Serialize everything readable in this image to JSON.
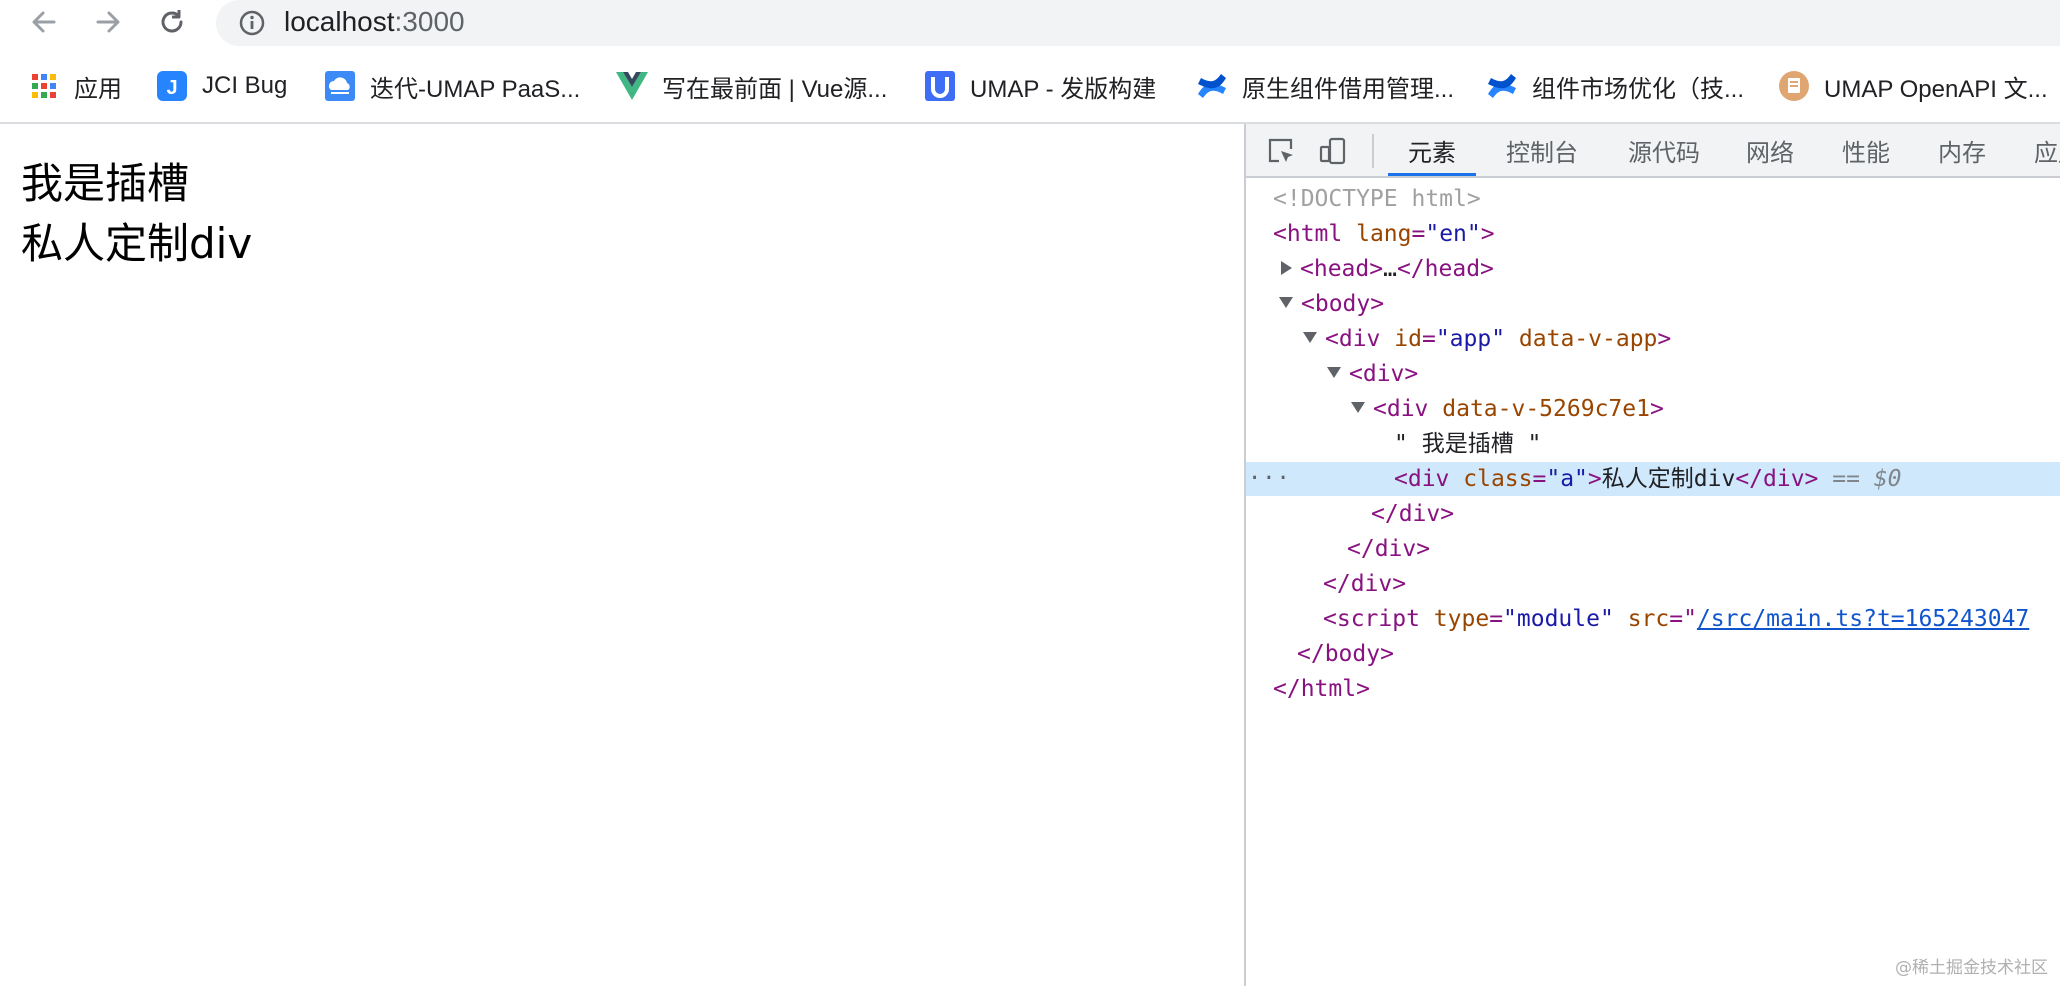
{
  "browser": {
    "url_host": "localhost",
    "url_port": ":3000"
  },
  "bookmarks": [
    {
      "label": "应用",
      "icon": "apps-grid-icon"
    },
    {
      "label": "JCI Bug",
      "icon": "jira-icon"
    },
    {
      "label": "迭代-UMAP PaaS...",
      "icon": "cloud-icon"
    },
    {
      "label": "写在最前面 | Vue源...",
      "icon": "vue-icon"
    },
    {
      "label": "UMAP - 发版构建",
      "icon": "umap-icon"
    },
    {
      "label": "原生组件借用管理...",
      "icon": "confluence-icon"
    },
    {
      "label": "组件市场优化（技...",
      "icon": "confluence-icon"
    },
    {
      "label": "UMAP OpenAPI 文...",
      "icon": "doc-icon"
    }
  ],
  "page": {
    "line1": "我是插槽",
    "line2": "私人定制div"
  },
  "devtools": {
    "tabs": [
      "元素",
      "控制台",
      "源代码",
      "网络",
      "性能",
      "内存",
      "应用"
    ],
    "active_tab": "元素",
    "tree": {
      "doctype": "<!DOCTYPE html>",
      "html_open_tag": "<html",
      "html_lang_attr": "lang",
      "html_lang_val": "\"en\"",
      "head_open": "<head>",
      "head_ellipsis": "…",
      "head_close": "</head>",
      "body_open": "<body>",
      "div_app_open": "<div",
      "div_app_id_attr": "id",
      "div_app_id_val": "\"app\"",
      "div_app_data_attr": "data-v-app",
      "div_plain_open": "<div>",
      "div_scoped_open": "<div",
      "div_scoped_attr": "data-v-5269c7e1",
      "text_node": "\" 我是插槽 \"",
      "div_a_open": "<div",
      "div_a_class_attr": "class",
      "div_a_class_val": "\"a\"",
      "div_a_text": "私人定制div",
      "div_a_close": "</div>",
      "selected_marker_eq": "==",
      "selected_marker_var": "$0",
      "div_close": "</div>",
      "script_open": "<script",
      "script_type_attr": "type",
      "script_type_val": "\"module\"",
      "script_src_attr": "src",
      "script_src_val": "/src/main.ts?t=165243047",
      "body_close": "</body>",
      "html_close": "</html>"
    }
  },
  "watermark": "@稀土掘金技术社区"
}
